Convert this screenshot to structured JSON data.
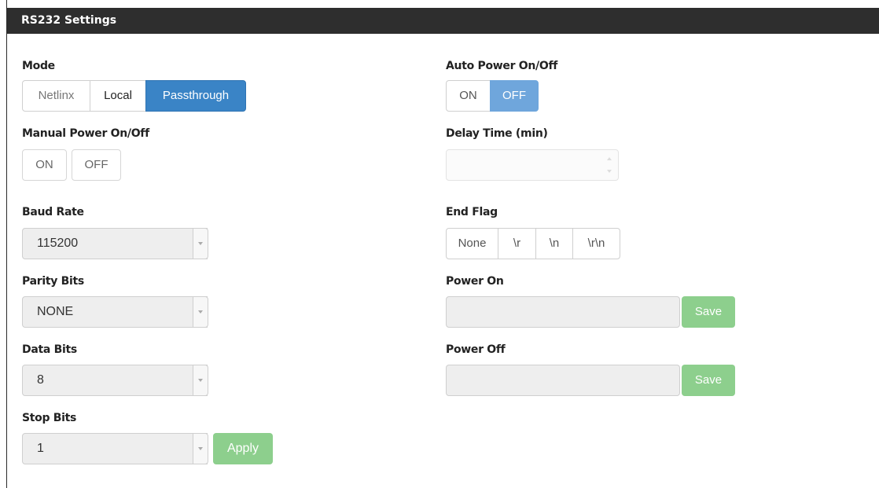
{
  "panel": {
    "title": "RS232 Settings"
  },
  "left": {
    "mode": {
      "label": "Mode",
      "options": [
        "Netlinx",
        "Local",
        "Passthrough"
      ],
      "selected": "Passthrough"
    },
    "manual_power": {
      "label": "Manual Power On/Off",
      "on": "ON",
      "off": "OFF"
    },
    "baud_rate": {
      "label": "Baud Rate",
      "value": "115200"
    },
    "parity_bits": {
      "label": "Parity Bits",
      "value": "NONE"
    },
    "data_bits": {
      "label": "Data Bits",
      "value": "8"
    },
    "stop_bits": {
      "label": "Stop Bits",
      "value": "1"
    },
    "apply_label": "Apply"
  },
  "right": {
    "auto_power": {
      "label": "Auto Power On/Off",
      "on": "ON",
      "off": "OFF",
      "selected": "OFF"
    },
    "delay_time": {
      "label": "Delay Time (min)",
      "value": ""
    },
    "end_flag": {
      "label": "End Flag",
      "options": [
        "None",
        "\\r",
        "\\n",
        "\\r\\n"
      ]
    },
    "power_on": {
      "label": "Power On",
      "value": "",
      "save_label": "Save"
    },
    "power_off": {
      "label": "Power Off",
      "value": "",
      "save_label": "Save"
    }
  },
  "colors": {
    "header_bg": "#2e2e2e",
    "primary_active": "#3a84c6",
    "primary_light": "#6fa6dc",
    "success_disabled": "#8dcf8d"
  }
}
